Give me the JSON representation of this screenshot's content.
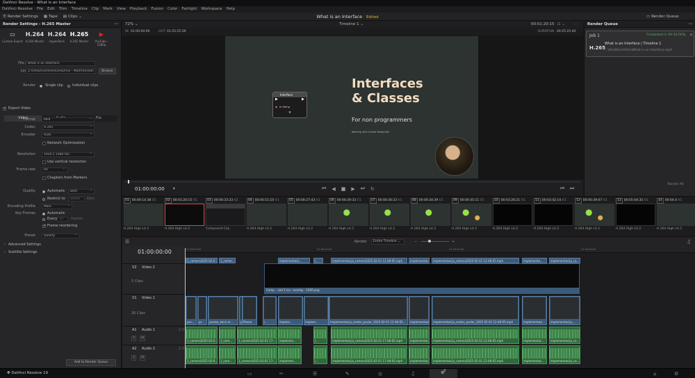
{
  "window": {
    "title": "DaVinci Resolve - What is an Interface"
  },
  "menu": [
    "DaVinci Resolve",
    "File",
    "Edit",
    "Trim",
    "Timeline",
    "Clip",
    "Mark",
    "View",
    "Playback",
    "Fusion",
    "Color",
    "Fairlight",
    "Workspace",
    "Help"
  ],
  "toolbar": {
    "render_settings": "Render Settings",
    "tape": "Tape",
    "clips": "Clips",
    "project": "What is an Interface",
    "edited": "Edited",
    "render_queue": "Render Queue"
  },
  "left": {
    "header": "Render Settings - H.265 Master",
    "presets": [
      {
        "big": "▭",
        "label": "Custom Export"
      },
      {
        "big": "H.264",
        "label": "H.264 Master"
      },
      {
        "big": "H.264",
        "label": "HyperDeck"
      },
      {
        "big": "H.265",
        "label": "H.265 Master"
      },
      {
        "big": "▶",
        "label": "YouTube - 1080p"
      }
    ],
    "file_name_label": "File Name",
    "file_name": "What is an Interface",
    "location_label": "Location",
    "location": "Z:\\OneDrive\\Files\\OneDrive - Malm\\OneDri",
    "browse": "Browse",
    "render_label": "Render",
    "single_clip": "Single clip",
    "individual_clips": "Individual clips",
    "tabs": [
      "Video",
      "Audio",
      "File"
    ],
    "export_video": "Export Video",
    "format_label": "Format",
    "format": "MP4",
    "codec_label": "Codec",
    "codec": "H.265",
    "encoder_label": "Encoder",
    "encoder": "Auto",
    "network_opt": "Network Optimization",
    "resolution_label": "Resolution",
    "resolution": "1920 x 1080 HD",
    "vertical_res": "Use vertical resolution",
    "frame_rate_label": "Frame rate",
    "frame_rate": "60",
    "chapters": "Chapters from Markers",
    "quality_label": "Quality",
    "automatic": "Automatic",
    "best": "Best",
    "restrict_to": "Restrict to",
    "kbs": "80000",
    "kbs_unit": "Kb/s",
    "encoding_profile_label": "Encoding Profile",
    "encoding_profile": "Main",
    "key_frames_label": "Key Frames",
    "kf_automatic": "Automatic",
    "every": "Every",
    "kf_num": "10",
    "frames": "frames",
    "frame_reordering": "Frame reordering",
    "preset_label": "Preset",
    "preset": "Quality",
    "advanced": "Advanced Settings",
    "subtitle": "Subtitle Settings",
    "add_queue": "Add to Render Queue"
  },
  "viewer": {
    "zoom": "72%",
    "timeline": "Timeline 1",
    "tc_top": "00:01:20:15",
    "in_label": "IN",
    "in": "01:00:00:00",
    "out_label": "OUT",
    "out": "01:25:25:39",
    "duration_label": "DURATION",
    "duration": "00:25:25:40",
    "current_tc": "01:00:00:00",
    "slide_title": [
      "Interfaces",
      "& Classes"
    ],
    "slide_sub": "For non programmers",
    "slide_small": "Working with Unreal Blueprints",
    "node_title": "Interface",
    "node_row": "In String"
  },
  "render_queue": {
    "header": "Render Queue",
    "job": "Job 1",
    "status": "Completed in 00:10:56",
    "codec": "H.265",
    "title": "What is an Interface | Timeline 1",
    "path": "...\\OneDrive\\Files\\What is an Interface.mp4",
    "render_all": "Render All"
  },
  "clips": [
    {
      "n": "01",
      "tc": "00:00:14:38",
      "tr": "V1",
      "f": "H.264 High L4.2",
      "thumb": "title",
      "sel": false
    },
    {
      "n": "02",
      "tc": "00:01:20:15",
      "tr": "V1",
      "f": "H.264 High L4.2",
      "thumb": "dark",
      "sel": true
    },
    {
      "n": "03",
      "tc": "00:00:33:33",
      "tr": "V2",
      "f": "Compound Clip",
      "thumb": "screen",
      "sel": false
    },
    {
      "n": "04",
      "tc": "00:00:15:10",
      "tr": "V1",
      "f": "H.264 High L4.2",
      "thumb": "title",
      "sel": false
    },
    {
      "n": "05",
      "tc": "00:00:27:43",
      "tr": "V1",
      "f": "H.264 High L4.2",
      "thumb": "slide",
      "sel": false
    },
    {
      "n": "06",
      "tc": "00:00:29:33",
      "tr": "V1",
      "f": "H.264 High L4.2",
      "thumb": "gun",
      "sel": false
    },
    {
      "n": "07",
      "tc": "00:00:30:23",
      "tr": "V1",
      "f": "H.264 High L4.2",
      "thumb": "gun",
      "sel": false
    },
    {
      "n": "08",
      "tc": "00:00:34:39",
      "tr": "V1",
      "f": "H.264 High L4.2",
      "thumb": "gun",
      "sel": false
    },
    {
      "n": "09",
      "tc": "00:00:35:11",
      "tr": "V1",
      "f": "H.264 High L4.2",
      "thumb": "gun2",
      "sel": false
    },
    {
      "n": "10",
      "tc": "00:03:26:21",
      "tr": "V1",
      "f": "H.264 High L4.2",
      "thumb": "black",
      "sel": false
    },
    {
      "n": "11",
      "tc": "00:03:42:14",
      "tr": "V1",
      "f": "H.264 High L4.2",
      "thumb": "black",
      "sel": false
    },
    {
      "n": "12",
      "tc": "00:00:39:07",
      "tr": "V1",
      "f": "H.264 High L4.2",
      "thumb": "gun2",
      "sel": false
    },
    {
      "n": "13",
      "tc": "00:05:04:35",
      "tr": "V1",
      "f": "H.264 High L4.2",
      "thumb": "black",
      "sel": false
    },
    {
      "n": "14",
      "tc": "00:04:4",
      "tr": "V1",
      "f": "H.264 High L4.2",
      "thumb": "slide",
      "sel": false
    }
  ],
  "timeline": {
    "render_label": "Render",
    "render_mode": "Entire Timeline",
    "tc": "01:00:00:00",
    "ruler": [
      "01:00:00:00",
      "01:08:20:00",
      "01:16:40:00",
      "01:25:00:00"
    ],
    "tracks": [
      {
        "id": "V2",
        "name": "Video 2",
        "clips": "5 Clips"
      },
      {
        "id": "V1",
        "name": "Video 1",
        "clips": "26 Clips"
      },
      {
        "id": "A1",
        "name": "Audio 1",
        "level": "2.0"
      },
      {
        "id": "A2",
        "name": "Audio 2",
        "level": "2.0"
      }
    ],
    "v2_clips": [
      {
        "l": 1,
        "w": 46,
        "t": "1_camera2025-02-0..."
      },
      {
        "l": 49,
        "w": 24,
        "t": "1_camer..."
      },
      {
        "l": 134,
        "w": 46,
        "t": "implementacij..."
      },
      {
        "l": 185,
        "w": 14,
        "t": "i..."
      },
      {
        "l": 210,
        "w": 110,
        "t": "implementacija_camera2025-02-01 12-48-05.mp4"
      },
      {
        "l": 322,
        "w": 30,
        "t": "implementac..."
      },
      {
        "l": 355,
        "w": 126,
        "t": "implementacija_camera2025-02-01 12-48-05.mp4"
      },
      {
        "l": 485,
        "w": 36,
        "t": "implementa..."
      },
      {
        "l": 524,
        "w": 45,
        "t": "implementacija_ca..."
      }
    ],
    "v2_compound": "Comp... sed 1 ica - ovarlay - 1920.png",
    "v1_clips": [
      {
        "l": 1,
        "w": 16,
        "t": "pro..."
      },
      {
        "l": 18,
        "w": 14,
        "t": "pr..."
      },
      {
        "l": 33,
        "w": 44,
        "t": "proska_ekrvi.m..."
      },
      {
        "l": 78,
        "w": 14,
        "t": "pro..."
      },
      {
        "l": 82,
        "w": 22,
        "t": "Phone"
      },
      {
        "l": 112,
        "w": 20,
        "t": "i..."
      },
      {
        "l": 134,
        "w": 36,
        "t": "implem..."
      },
      {
        "l": 171,
        "w": 36,
        "t": "implem..."
      },
      {
        "l": 207,
        "w": 114,
        "t": "implementacija_sredss_poslar_2025-02-01 12-48-05..."
      },
      {
        "l": 322,
        "w": 30,
        "t": "implementaci..."
      },
      {
        "l": 355,
        "w": 126,
        "t": "implementacija_sredss_poslar_2025-02-01 12-48-05.mp4"
      },
      {
        "l": 485,
        "w": 36,
        "t": "implementaci..."
      },
      {
        "l": 524,
        "w": 45,
        "t": "implementacija_..."
      }
    ],
    "a_clips": [
      {
        "l": 1,
        "w": 46,
        "t": "1_camera2025-02-0..."
      },
      {
        "l": 49,
        "w": 24,
        "t": "1_cam..."
      },
      {
        "l": 75,
        "w": 58,
        "t": "1_camera2025-02-01 17-..."
      },
      {
        "l": 134,
        "w": 34,
        "t": "implemen..."
      },
      {
        "l": 185,
        "w": 20,
        "t": "i..."
      },
      {
        "l": 210,
        "w": 110,
        "t": "implementacija_camera2025-02-01 17-48-05.mp4"
      },
      {
        "l": 322,
        "w": 30,
        "t": "implementac..."
      },
      {
        "l": 355,
        "w": 126,
        "t": "implementacija_camera2025-02-01 12-48-05.mp4"
      },
      {
        "l": 485,
        "w": 36,
        "t": "implementac..."
      },
      {
        "l": 524,
        "w": 45,
        "t": "implementacija_ca..."
      }
    ]
  },
  "status": {
    "app": "DaVinci Resolve 19"
  },
  "colors": {
    "accent_red": "#d44444",
    "video_clip": "#3c5a7a",
    "audio_clip": "#2e6a3a",
    "edited": "#e6b422",
    "status_ok": "#5fae5f"
  }
}
